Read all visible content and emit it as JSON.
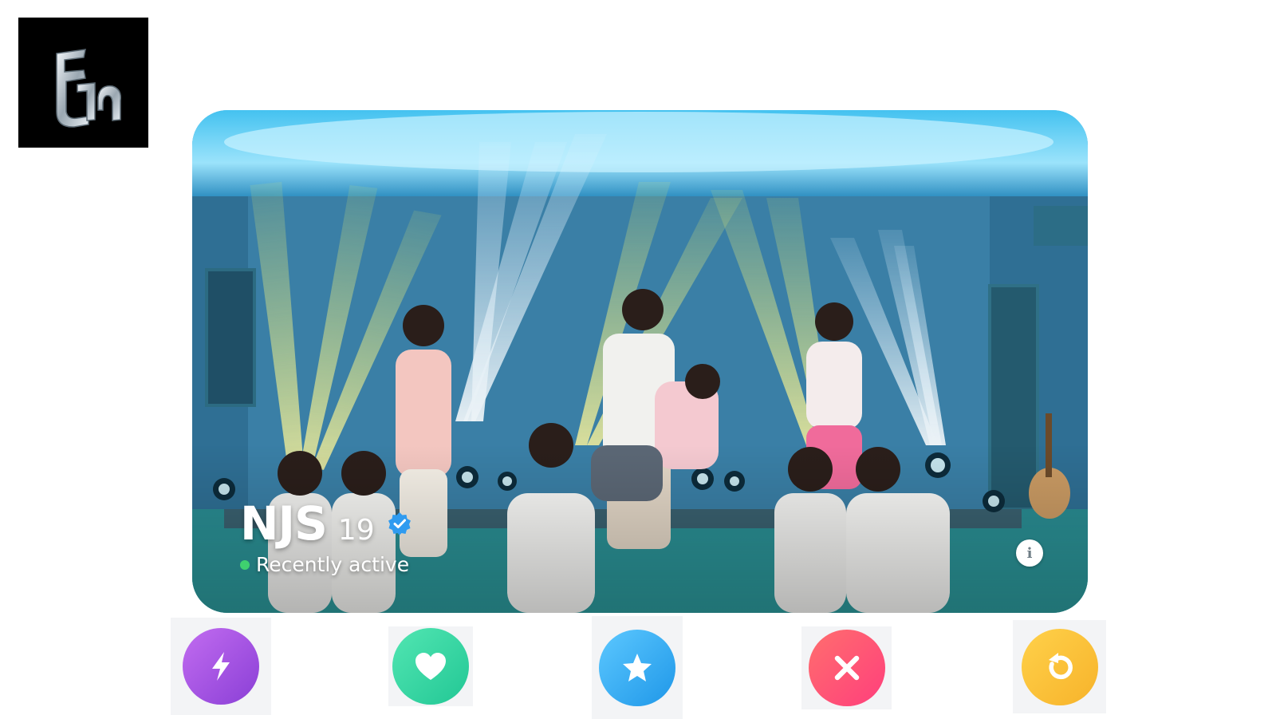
{
  "app": {
    "logo_icon": "stylized-monogram-logo"
  },
  "profile": {
    "name": "NJS",
    "age": "19",
    "verified_icon": "verified-check-icon",
    "status": "Recently active",
    "status_color": "#3fd06f",
    "info_label": "i"
  },
  "actions": [
    {
      "icon": "lightning-icon",
      "color": "#9b4ee0"
    },
    {
      "icon": "heart-icon",
      "color": "#2fd3a0"
    },
    {
      "icon": "star-icon",
      "color": "#2aa6f0"
    },
    {
      "icon": "close-icon",
      "color": "#ff4f6e"
    },
    {
      "icon": "rewind-icon",
      "color": "#f9be35"
    }
  ]
}
